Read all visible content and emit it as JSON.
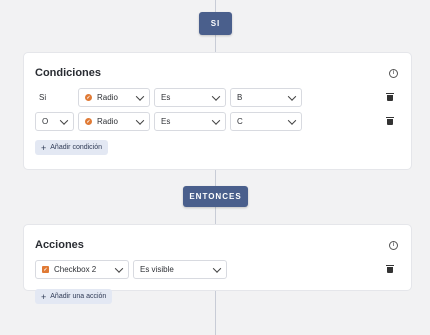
{
  "if_label": "SI",
  "then_label": "ENTONCES",
  "conditions": {
    "title": "Condiciones",
    "rows": [
      {
        "connector": "Si",
        "field": "Radio",
        "operator": "Es",
        "value": "B"
      },
      {
        "connector": "O",
        "field": "Radio",
        "operator": "Es",
        "value": "C"
      }
    ],
    "add_label": "Añadir condición"
  },
  "actions": {
    "title": "Acciones",
    "rows": [
      {
        "field": "Checkbox 2",
        "action": "Es visible"
      }
    ],
    "add_label": "Añadir una acción"
  },
  "colors": {
    "accent": "#4a5f8c",
    "field_icon": "#e07a35"
  },
  "icons": {
    "info": "info-icon",
    "delete": "trash-icon",
    "add": "plus-icon",
    "dropdown": "chevron-down-icon"
  }
}
